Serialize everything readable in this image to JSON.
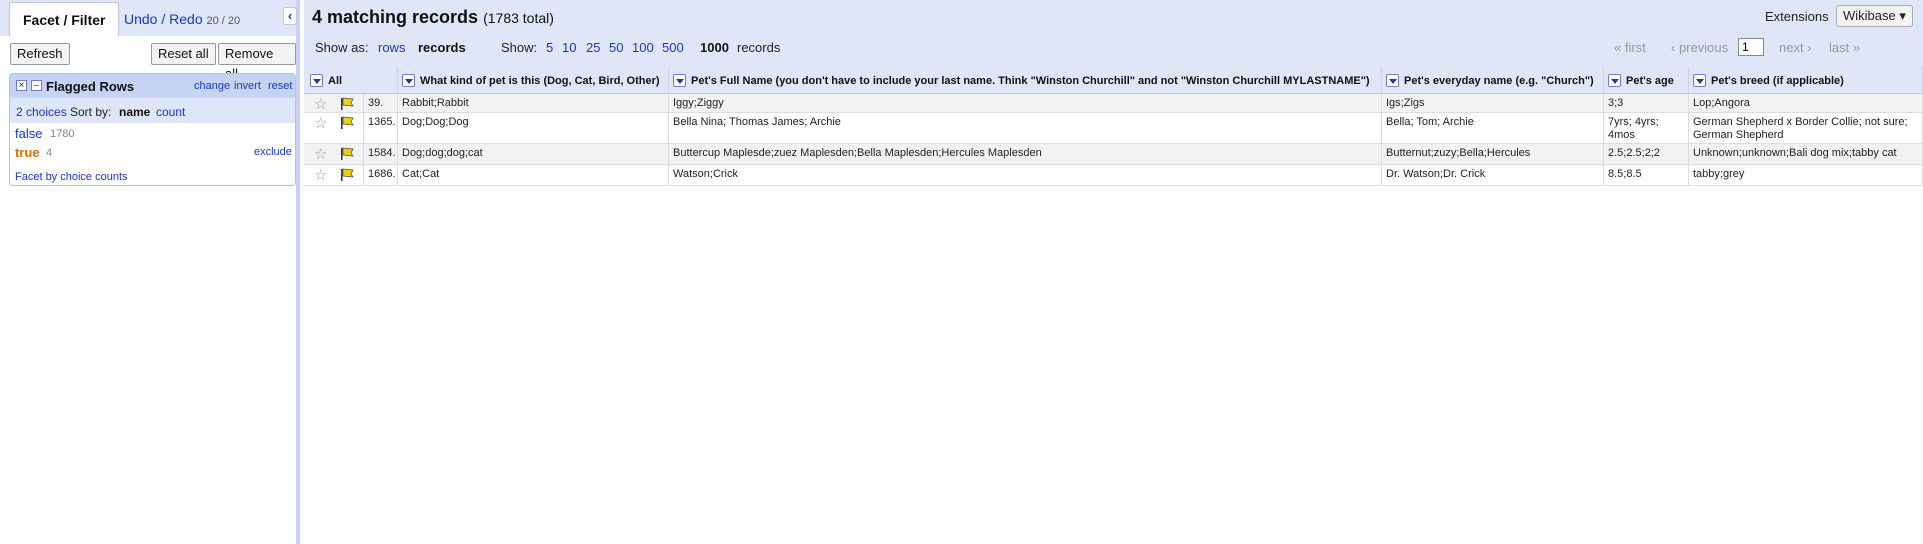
{
  "left": {
    "tabs": {
      "facet_filter": "Facet / Filter",
      "undo_redo": "Undo / Redo",
      "undo_count": "20 / 20"
    },
    "buttons": {
      "refresh": "Refresh",
      "reset_all": "Reset all",
      "remove_all": "Remove all"
    },
    "facet": {
      "title": "Flagged Rows",
      "change": "change",
      "invert": "invert",
      "reset": "reset",
      "choices": "2 choices",
      "sort_by": "Sort by:",
      "sort_name": "name",
      "sort_count": "count",
      "items": [
        {
          "label": "false",
          "count": "1780"
        },
        {
          "label": "true",
          "count": "4",
          "action": "exclude"
        }
      ],
      "facet_by_counts": "Facet by choice counts"
    }
  },
  "summary": {
    "count": "4 matching records",
    "total": "(1783 total)",
    "extensions_label": "Extensions",
    "wikibase": "Wikibase ▾"
  },
  "view": {
    "show_as": "Show as:",
    "rows": "rows",
    "records": "records",
    "show": "Show:",
    "page_sizes": [
      "5",
      "10",
      "25",
      "50",
      "100",
      "500",
      "1000"
    ],
    "records_word": "records",
    "first": "« first",
    "previous": "‹ previous",
    "page_value": "1",
    "next": "next ›",
    "last": "last »"
  },
  "grid": {
    "all_label": "All",
    "columns": [
      "What kind of pet is this (Dog, Cat, Bird, Other)",
      "Pet's Full Name (you don't have to include your last name. Think \"Winston Churchill\" and not \"Winston Churchill MYLASTNAME\")",
      "Pet's everyday name (e.g. \"Church\")",
      "Pet's age",
      "Pet's breed (if applicable)"
    ],
    "rows": [
      {
        "num": "39.",
        "cells": [
          "Rabbit;Rabbit",
          "Iggy;Ziggy",
          "Igs;Zigs",
          "3;3",
          "Lop;Angora"
        ]
      },
      {
        "num": "1365.",
        "cells": [
          "Dog;Dog;Dog",
          "Bella Nina; Thomas James; Archie",
          "Bella; Tom; Archie",
          "7yrs; 4yrs; 4mos",
          "German Shepherd x Border Collie; not sure; German Shepherd"
        ]
      },
      {
        "num": "1584.",
        "cells": [
          "Dog;dog;dog;cat",
          "Buttercup Maplesde;zuez Maplesden;Bella Maplesden;Hercules Maplesden",
          "Butternut;zuzy;Bella;Hercules",
          "2.5;2.5;2;2",
          "Unknown;unknown;Bali dog mix;tabby cat"
        ]
      },
      {
        "num": "1686.",
        "cells": [
          "Cat;Cat",
          "Watson;Crick",
          "Dr. Watson;Dr. Crick",
          "8.5;8.5",
          "tabby;grey"
        ]
      }
    ]
  },
  "colors": {
    "panel_bg": "#dfe6f8",
    "link": "#1a37c4",
    "true_choice": "#e07000",
    "flag_yellow": "#f0d000"
  }
}
